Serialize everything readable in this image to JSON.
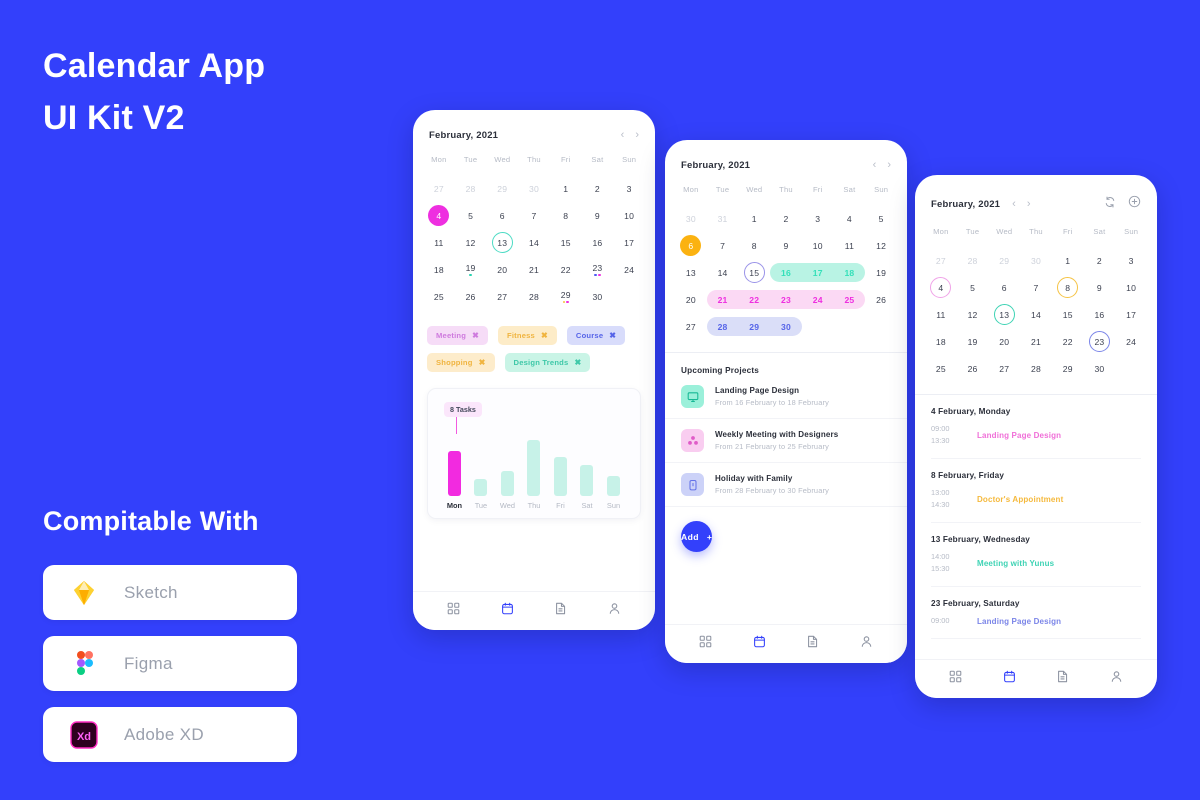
{
  "theme": {
    "background": "#3340fb",
    "accent": "#3340fb",
    "card": "#ffffff"
  },
  "promo": {
    "title_line1": "Calendar App",
    "title_line2": "UI Kit V2",
    "compat_heading": "Compitable With",
    "compat_items": [
      {
        "name": "Sketch",
        "icon": "sketch-logo"
      },
      {
        "name": "Figma",
        "icon": "figma-logo"
      },
      {
        "name": "Adobe XD",
        "icon": "adobe-xd-logo"
      }
    ]
  },
  "nav": {
    "items": [
      {
        "icon": "grid-icon",
        "label": "Dashboard",
        "active": false
      },
      {
        "icon": "calendar-icon",
        "label": "Calendar",
        "active": true
      },
      {
        "icon": "document-icon",
        "label": "Documents",
        "active": false
      },
      {
        "icon": "person-icon",
        "label": "Profile",
        "active": false
      }
    ]
  },
  "phone1": {
    "month": "February, 2021",
    "prev": "‹",
    "next": "›",
    "dow": [
      "Mon",
      "Tue",
      "Wed",
      "Thu",
      "Fri",
      "Sat",
      "Sun"
    ],
    "weeks": [
      [
        {
          "n": "27",
          "muted": true
        },
        {
          "n": "28",
          "muted": true
        },
        {
          "n": "29",
          "muted": true
        },
        {
          "n": "30",
          "muted": true
        },
        {
          "n": "1"
        },
        {
          "n": "2"
        },
        {
          "n": "3"
        }
      ],
      [
        {
          "n": "4",
          "fill": "#ee2fe0",
          "textColor": "#ffffff"
        },
        {
          "n": "5"
        },
        {
          "n": "6"
        },
        {
          "n": "7"
        },
        {
          "n": "8"
        },
        {
          "n": "9"
        },
        {
          "n": "10"
        }
      ],
      [
        {
          "n": "11"
        },
        {
          "n": "12"
        },
        {
          "n": "13",
          "ring": "#4ddbc4"
        },
        {
          "n": "14"
        },
        {
          "n": "15"
        },
        {
          "n": "16"
        },
        {
          "n": "17"
        }
      ],
      [
        {
          "n": "18"
        },
        {
          "n": "19",
          "dots": [
            "#2ad4b0"
          ]
        },
        {
          "n": "20"
        },
        {
          "n": "21"
        },
        {
          "n": "22"
        },
        {
          "n": "23",
          "dots": [
            "#4d5bf5",
            "#ee2fe0"
          ]
        },
        {
          "n": "24"
        }
      ],
      [
        {
          "n": "25"
        },
        {
          "n": "26"
        },
        {
          "n": "27"
        },
        {
          "n": "28"
        },
        {
          "n": "29",
          "dots": [
            "#f7c13c",
            "#ee2fe0"
          ]
        },
        {
          "n": "30"
        },
        {
          "n": ""
        }
      ]
    ],
    "tags": [
      {
        "label": "Meeting",
        "bg": "#f6dcf7",
        "fg": "#cf7ade",
        "close": "✖"
      },
      {
        "label": "Fitness",
        "bg": "#fdecc8",
        "fg": "#f0b43f",
        "close": "✖"
      },
      {
        "label": "Course",
        "bg": "#d8dcfb",
        "fg": "#5664e8",
        "close": "✖"
      },
      {
        "label": "Shopping",
        "bg": "#fdeccb",
        "fg": "#f0b43f",
        "close": "✖"
      },
      {
        "label": "Design Trends",
        "bg": "#c9f4e6",
        "fg": "#3ec8a8",
        "close": "✖"
      }
    ],
    "chart_data": {
      "type": "bar",
      "title": "8 Tasks",
      "categories": [
        "Mon",
        "Tue",
        "Wed",
        "Thu",
        "Fri",
        "Sat",
        "Sun"
      ],
      "values": [
        8,
        3,
        4.5,
        10,
        7,
        5.5,
        3.5
      ],
      "ylim": [
        0,
        11
      ],
      "xlabel": "",
      "ylabel": "",
      "grid": false,
      "legend": "none",
      "highlight_index": 0,
      "highlight_color": "#f22ae0",
      "bar_color": "#c7f2e8",
      "annotation": "8 Tasks"
    }
  },
  "phone2": {
    "month": "February, 2021",
    "prev": "‹",
    "next": "›",
    "dow": [
      "Mon",
      "Tue",
      "Wed",
      "Thu",
      "Fri",
      "Sat",
      "Sun"
    ],
    "weeks": [
      [
        {
          "n": "30",
          "muted": true
        },
        {
          "n": "31",
          "muted": true
        },
        {
          "n": "1"
        },
        {
          "n": "2"
        },
        {
          "n": "3"
        },
        {
          "n": "4"
        },
        {
          "n": "5"
        }
      ],
      [
        {
          "n": "6",
          "fill": "#fbb211",
          "textColor": "#ffffff"
        },
        {
          "n": "7"
        },
        {
          "n": "8"
        },
        {
          "n": "9"
        },
        {
          "n": "10"
        },
        {
          "n": "11"
        },
        {
          "n": "12"
        }
      ],
      [
        {
          "n": "13"
        },
        {
          "n": "14"
        },
        {
          "n": "15",
          "ring": "#9a93e8"
        },
        {
          "n": "16",
          "bandColor": "#33e0b9"
        },
        {
          "n": "17",
          "bandColor": "#33e0b9"
        },
        {
          "n": "18",
          "bandColor": "#33e0b9"
        },
        {
          "n": "19"
        }
      ],
      [
        {
          "n": "20"
        },
        {
          "n": "21",
          "bandColor": "#ee2fe0"
        },
        {
          "n": "22",
          "bandColor": "#ee2fe0"
        },
        {
          "n": "23",
          "bandColor": "#ee2fe0"
        },
        {
          "n": "24",
          "bandColor": "#ee2fe0"
        },
        {
          "n": "25",
          "bandColor": "#ee2fe0"
        },
        {
          "n": "26"
        }
      ],
      [
        {
          "n": "27"
        },
        {
          "n": "28",
          "bandColor": "#5664e8"
        },
        {
          "n": "29",
          "bandColor": "#5664e8"
        },
        {
          "n": "30",
          "bandColor": "#5664e8"
        },
        {
          "n": ""
        },
        {
          "n": ""
        },
        {
          "n": ""
        }
      ]
    ],
    "bands": [
      {
        "row": 2,
        "start": 3,
        "end": 5,
        "bg": "#b9f3e4"
      },
      {
        "row": 3,
        "start": 1,
        "end": 5,
        "bg": "#fbd9f4"
      },
      {
        "row": 4,
        "start": 1,
        "end": 3,
        "bg": "#dadef8"
      }
    ],
    "section_title": "Upcoming Projects",
    "projects": [
      {
        "title": "Landing Page Design",
        "subtitle": "From 16 February to 18 February",
        "icon": "monitor-icon",
        "icon_bg": "#9bf0da",
        "icon_fg": "#16b894"
      },
      {
        "title": "Weekly Meeting with Designers",
        "subtitle": "From 21 February to 25 February",
        "icon": "group-icon",
        "icon_bg": "#f9cdf0",
        "icon_fg": "#e05bc8"
      },
      {
        "title": "Holiday with Family",
        "subtitle": "From 28 February to 30 February",
        "icon": "suitcase-icon",
        "icon_bg": "#ccd2f8",
        "icon_fg": "#6472e8"
      }
    ],
    "add_label": "Add",
    "add_plus": "+"
  },
  "phone3": {
    "month": "February, 2021",
    "prev": "‹",
    "next": "›",
    "sync_icon": "sync-icon",
    "add_icon": "plus-circle-icon",
    "dow": [
      "Mon",
      "Tue",
      "Wed",
      "Thu",
      "Fri",
      "Sat",
      "Sun"
    ],
    "weeks": [
      [
        {
          "n": "27",
          "muted": true
        },
        {
          "n": "28",
          "muted": true
        },
        {
          "n": "29",
          "muted": true
        },
        {
          "n": "30",
          "muted": true
        },
        {
          "n": "1"
        },
        {
          "n": "2"
        },
        {
          "n": "3"
        }
      ],
      [
        {
          "n": "4",
          "ring": "#f0a3e8"
        },
        {
          "n": "5"
        },
        {
          "n": "6"
        },
        {
          "n": "7"
        },
        {
          "n": "8",
          "ring": "#f5c councils"
        },
        {
          "n": "9"
        },
        {
          "n": "10"
        }
      ],
      [
        {
          "n": "11"
        },
        {
          "n": "12"
        },
        {
          "n": "13",
          "ring": "#3ed3b4"
        },
        {
          "n": "14"
        },
        {
          "n": "15"
        },
        {
          "n": "16"
        },
        {
          "n": "17"
        }
      ],
      [
        {
          "n": "18"
        },
        {
          "n": "19"
        },
        {
          "n": "20"
        },
        {
          "n": "21"
        },
        {
          "n": "22"
        },
        {
          "n": "23",
          "ring": "#7b85e8"
        },
        {
          "n": "24"
        }
      ],
      [
        {
          "n": "25"
        },
        {
          "n": "26"
        },
        {
          "n": "27"
        },
        {
          "n": "28"
        },
        {
          "n": "29"
        },
        {
          "n": "30"
        },
        {
          "n": ""
        }
      ]
    ],
    "agenda": [
      {
        "day": "4 February, Monday",
        "start": "09:00",
        "end": "13:30",
        "title": "Landing Page Design",
        "color": "#f06fd8"
      },
      {
        "day": "8 February, Friday",
        "start": "13:00",
        "end": "14:30",
        "title": "Doctor's Appointment",
        "color": "#f5b93c"
      },
      {
        "day": "13 February, Wednesday",
        "start": "14:00",
        "end": "15:30",
        "title": "Meeting with Yunus",
        "color": "#3ed3b4"
      },
      {
        "day": "23 February, Saturday",
        "start": "09:00",
        "end": "",
        "title": "Landing Page Design",
        "color": "#7b85e8"
      }
    ]
  }
}
